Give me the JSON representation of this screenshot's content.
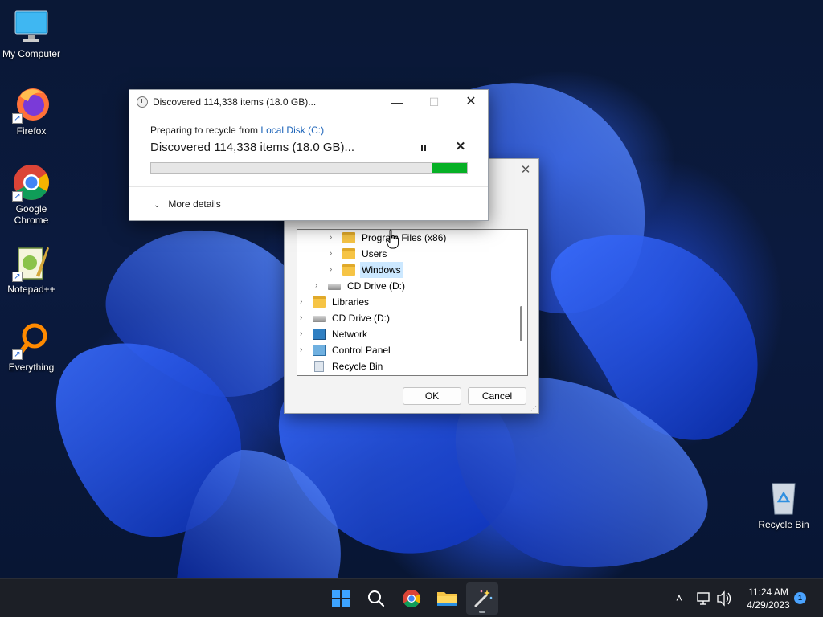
{
  "desktop": {
    "icons": [
      {
        "label": "My Computer",
        "icon": "monitor-icon"
      },
      {
        "label": "Firefox",
        "icon": "firefox-icon"
      },
      {
        "label": "Google\nChrome",
        "icon": "chrome-icon"
      },
      {
        "label": "Notepad++",
        "icon": "notepadpp-icon"
      },
      {
        "label": "Everything",
        "icon": "everything-search-icon"
      }
    ],
    "recycle_bin": {
      "label": "Recycle Bin",
      "icon": "recycle-bin-icon"
    }
  },
  "progress_dialog": {
    "title": "Discovered 114,338 items (18.0 GB)...",
    "subtitle_prefix": "Preparing to recycle from ",
    "subtitle_link": "Local Disk (C:)",
    "main_text": "Discovered 114,338 items (18.0 GB)...",
    "progress_fraction": 0.89,
    "more_details_label": "More details",
    "progress_color": "#06b025"
  },
  "browse_dialog": {
    "tree": [
      {
        "label": "Program Files (x86)",
        "icon": "folder-icon",
        "level": 2,
        "selected": false
      },
      {
        "label": "Users",
        "icon": "folder-icon",
        "level": 2,
        "selected": false
      },
      {
        "label": "Windows",
        "icon": "folder-icon",
        "level": 2,
        "selected": true
      },
      {
        "label": "CD Drive (D:)",
        "icon": "cd-drive-icon",
        "level": 1,
        "selected": false
      },
      {
        "label": "Libraries",
        "icon": "libraries-icon",
        "level": 0,
        "selected": false
      },
      {
        "label": "CD Drive (D:)",
        "icon": "cd-drive-icon",
        "level": 0,
        "selected": false
      },
      {
        "label": "Network",
        "icon": "network-icon",
        "level": 0,
        "selected": false
      },
      {
        "label": "Control Panel",
        "icon": "control-panel-icon",
        "level": 0,
        "selected": false
      },
      {
        "label": "Recycle Bin",
        "icon": "recycle-bin-icon",
        "level": 0,
        "selected": false
      }
    ],
    "ok_label": "OK",
    "cancel_label": "Cancel"
  },
  "taskbar": {
    "apps": [
      "start-icon",
      "search-icon",
      "chrome-icon",
      "file-explorer-icon",
      "magic-wand-icon"
    ],
    "clock_time": "11:24 AM",
    "clock_date": "4/29/2023",
    "notification_count": "1"
  }
}
